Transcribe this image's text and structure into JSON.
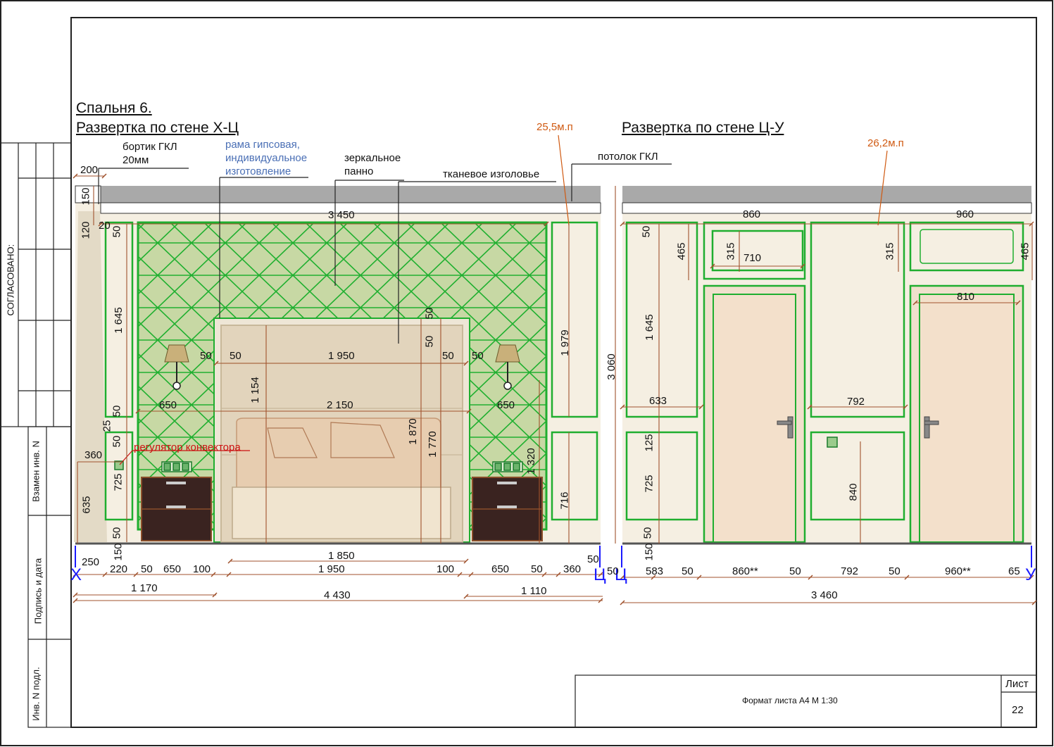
{
  "sheet": {
    "approved_label": "СОГЛАСОВАНО:",
    "stamp_labels": [
      "Взамен инв. N",
      "Подпись и дата",
      "Инв. N подл."
    ],
    "format_label": "Формат листа А4 М 1:30",
    "sheet_label": "Лист",
    "sheet_number": "22"
  },
  "titles": {
    "room": "Спальня 6.",
    "wall_1": "Развертка по стене Х-Ц",
    "wall_2": "Развертка по стене Ц-У"
  },
  "notes": {
    "board_line1": "бортик ГКЛ",
    "board_line2": "20мм",
    "frame_line1": "рама гипсовая,",
    "frame_line2": "индивидуальное",
    "frame_line3": "изготовление",
    "mirror_line1": "зеркальное",
    "mirror_line2": "панно",
    "headboard": "тканевое изголовье",
    "ceiling": "потолок ГКЛ",
    "molding_1": "25,5м.п",
    "molding_2": "26,2м.п",
    "regulator": "регулятор конвектора"
  },
  "axes": {
    "x": "Х",
    "c_left": "Ц",
    "c_right": "Ц",
    "y": "У"
  },
  "dims_left": {
    "d200": "200",
    "d150a": "150",
    "d120": "120",
    "d20": "20",
    "d3450": "3 450",
    "d50a": "50",
    "d1645": "1 645",
    "d50b": "50",
    "d25": "25",
    "d50c": "50",
    "d725": "725",
    "d360a": "360",
    "d635": "635",
    "d50d": "50",
    "d150b": "150",
    "d1979": "1 979",
    "d716": "716",
    "d3060": "3 060",
    "d50e": "50",
    "d50f": "50",
    "d1950a": "1 950",
    "d50g": "50",
    "d50h": "50",
    "d50i": "50",
    "d50j": "50",
    "d650a": "650",
    "d2150": "2 150",
    "d650b": "650",
    "d1154": "1 154",
    "d1870": "1 870",
    "d1770": "1 770",
    "d1320": "1 320",
    "d1850": "1 850",
    "b250": "250",
    "b220": "220",
    "b50a": "50",
    "b650a": "650",
    "b100a": "100",
    "b1950": "1 950",
    "b100b": "100",
    "b650b": "650",
    "b50b": "50",
    "b360": "360",
    "b50c": "50",
    "b1170": "1 170",
    "b4430": "4 430",
    "b1110": "1 110"
  },
  "dims_right": {
    "d860": "860",
    "d960": "960",
    "d50a": "50",
    "d465a": "465",
    "d315a": "315",
    "d710": "710",
    "d315b": "315",
    "d465b": "465",
    "d810": "810",
    "d1645": "1 645",
    "d633": "633",
    "d792": "792",
    "d125": "125",
    "d725": "725",
    "d840": "840",
    "d50b": "50",
    "d150": "150",
    "b50a": "50",
    "b583": "583",
    "b50b": "50",
    "b860": "860**",
    "b50c": "50",
    "b792": "792",
    "b50d": "50",
    "b960": "960**",
    "b65": "65",
    "b3460": "3 460"
  },
  "colors": {
    "frame_green": "#1fae2f",
    "dimension": "#a0522d",
    "annotation_orange": "#d05a12",
    "annotation_blue": "#4a6fb5",
    "regulator_red": "#cc1111",
    "ceiling_grey": "#a9a9a9",
    "axis_blue": "#1a1aff"
  }
}
